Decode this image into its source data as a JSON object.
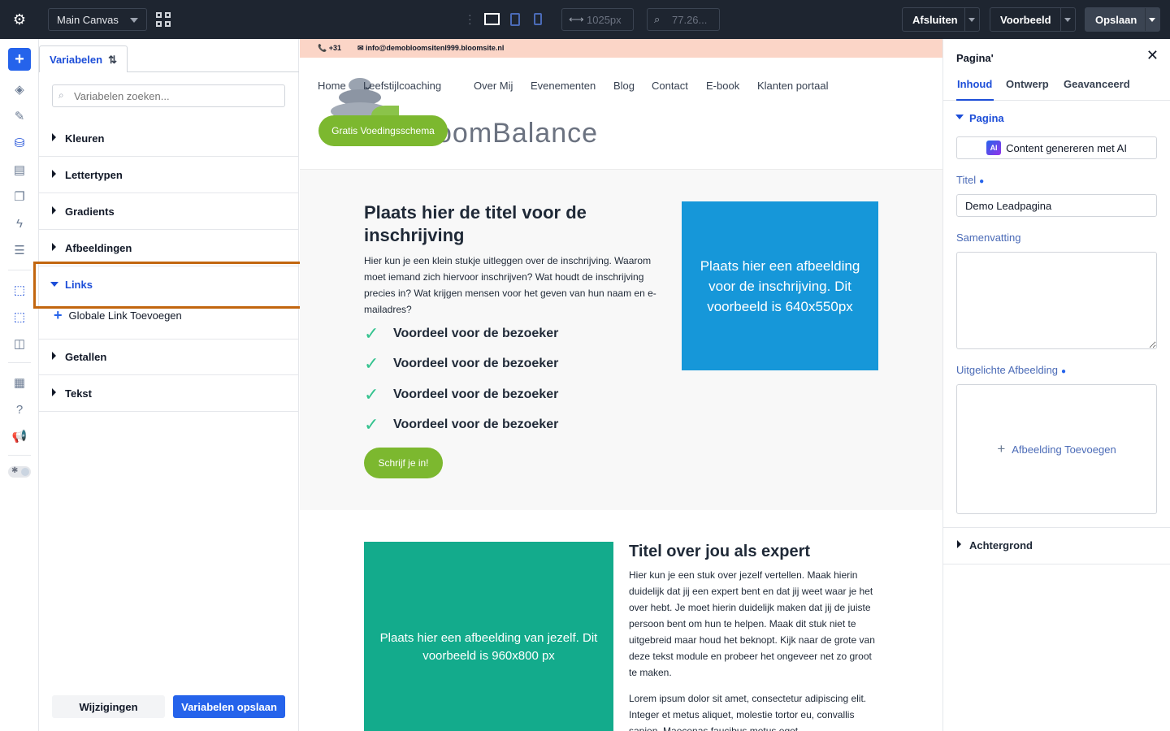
{
  "topbar": {
    "canvas_select": "Main Canvas",
    "width_value": "1025px",
    "zoom_value": "77.26...",
    "close_label": "Afsluiten",
    "preview_label": "Voorbeeld",
    "save_label": "Opslaan"
  },
  "variables_panel": {
    "tab_label": "Variabelen",
    "search_placeholder": "Variabelen zoeken...",
    "sections": [
      "Kleuren",
      "Lettertypen",
      "Gradients",
      "Afbeeldingen",
      "Links",
      "Getallen",
      "Tekst"
    ],
    "open_section": "Links",
    "add_link_label": "Globale Link Toevoegen",
    "changes_button": "Wijzigingen",
    "save_button": "Variabelen opslaan"
  },
  "canvas": {
    "phone": "+31",
    "email": "info@demobloomsitenl999.bloomsite.nl",
    "nav": [
      "Home",
      "Leefstijlcoaching",
      "Over Mij",
      "Evenementen",
      "Blog",
      "Contact",
      "E-book",
      "Klanten portaal"
    ],
    "logo_text": "oomBalance",
    "cta_label": "Gratis Voedingsschema",
    "hero_title": "Plaats hier de titel voor de inschrijving",
    "hero_text": "Hier kun je een klein stukje uitleggen over de inschrijving. Waarom moet iemand zich hiervoor inschrijven? Wat houdt de inschrijving precies in? Wat krijgen mensen voor het geven van hun naam en e-mailadres?",
    "benefits": [
      "Voordeel voor de bezoeker",
      "Voordeel voor de bezoeker",
      "Voordeel voor de bezoeker",
      "Voordeel voor de bezoeker"
    ],
    "signup_label": "Schrijf je in!",
    "blue_image_text": "Plaats hier een afbeelding voor de inschrijving. Dit voorbeeld is 640x550px",
    "green_image_text": "Plaats hier een afbeelding van jezelf. Dit voorbeeld is 960x800 px",
    "expert_title": "Titel over jou als expert",
    "expert_text": "Hier kun je een stuk over jezelf vertellen. Maak hierin duidelijk dat jij een expert bent en dat jij weet waar je het over hebt. Je moet hierin duidelijk maken dat jij de juiste persoon bent om hun te helpen. Maak dit stuk niet te uitgebreid maar houd het beknopt. Kijk naar de grote van deze tekst module en probeer het ongeveer net zo groot te maken.",
    "expert_text2": "Lorem ipsum dolor sit amet, consectetur adipiscing elit. Integer et metus aliquet, molestie tortor eu, convallis sapien. Maecenas faucibus metus eget."
  },
  "right_panel": {
    "title": "Pagina'",
    "tabs": [
      "Inhoud",
      "Ontwerp",
      "Geavanceerd"
    ],
    "section_page": "Pagina",
    "ai_button": "Content genereren met AI",
    "ai_badge": "AI",
    "title_label": "Titel",
    "title_value": "Demo Leadpagina",
    "summary_label": "Samenvatting",
    "featured_label": "Uitgelichte Afbeelding",
    "add_image_label": "Afbeelding Toevoegen",
    "section_background": "Achtergrond"
  }
}
